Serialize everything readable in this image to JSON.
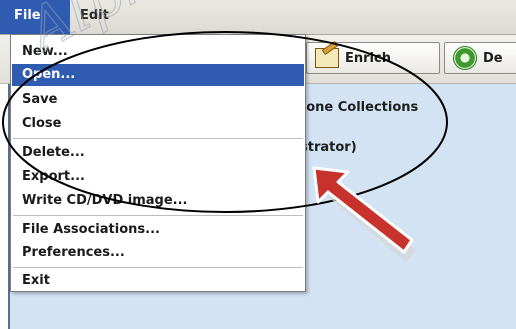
{
  "menubar": {
    "file_label": "File",
    "edit_label": "Edit"
  },
  "toolbar": {
    "enrich_label": "Enrich",
    "describe_label": "De"
  },
  "content": {
    "line1": "tone Collections",
    "line2": "strator)"
  },
  "file_menu": {
    "items": [
      {
        "label": "New..."
      },
      {
        "label": "Open..."
      },
      {
        "label": "Save"
      },
      {
        "label": "Close"
      },
      {
        "label": "Delete..."
      },
      {
        "label": "Export..."
      },
      {
        "label": "Write CD/DVD image..."
      },
      {
        "label": "File Associations..."
      },
      {
        "label": "Preferences..."
      },
      {
        "label": "Exit"
      }
    ],
    "selected": "Open..."
  },
  "annotations": {
    "highlight_ellipse_color": "#000000",
    "arrow_color": "#c8322c",
    "watermark_text": "Alpha"
  },
  "colors": {
    "selection": "#2f5bb1",
    "content_background": "#d3e3f4"
  }
}
